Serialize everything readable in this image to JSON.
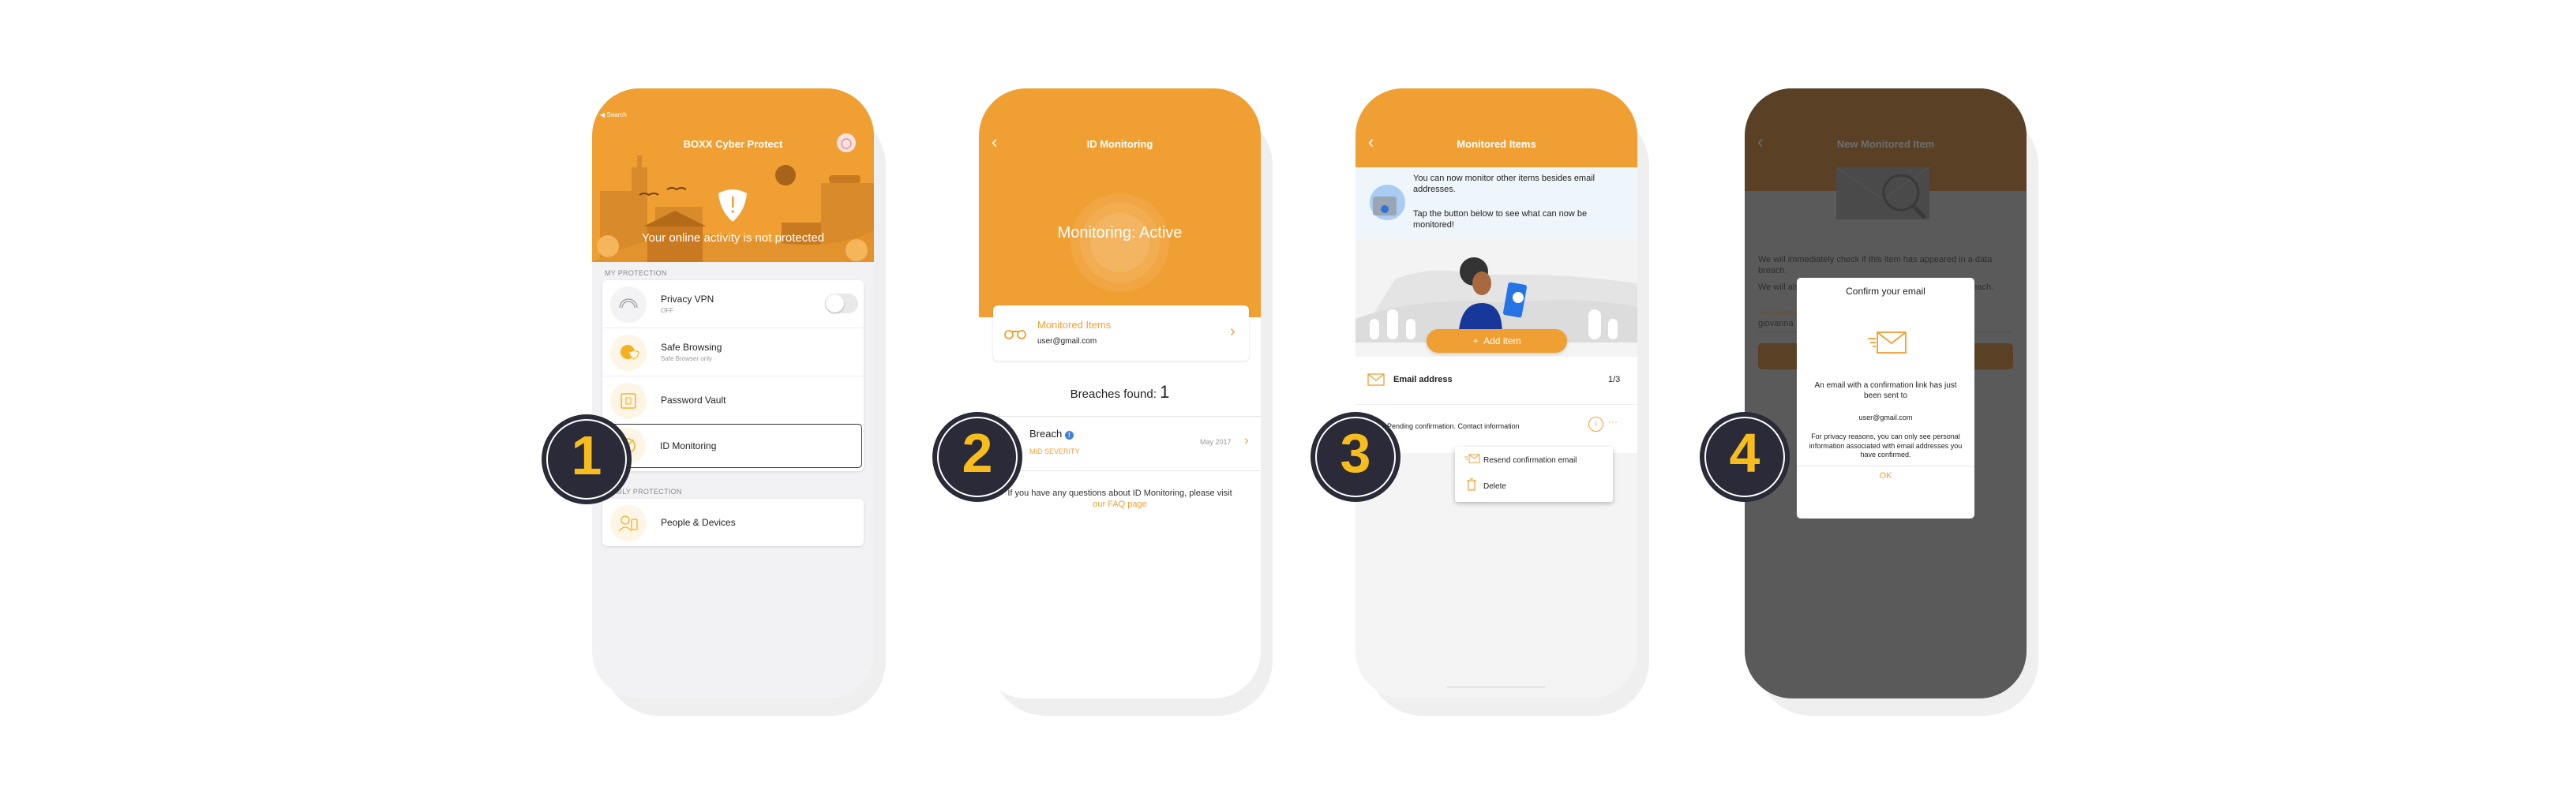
{
  "steps": [
    "1",
    "2",
    "3",
    "4"
  ],
  "colors": {
    "brand_orange": "#f09f33",
    "badge_bg": "#2a2a38",
    "badge_num": "#f6bd1d",
    "overlay": "#5a5a5a"
  },
  "screen1": {
    "back_label": "Search",
    "title": "BOXX Cyber Protect",
    "hero_status": "Your online activity is not protected",
    "section_my": "MY PROTECTION",
    "items": [
      {
        "label": "Privacy VPN",
        "sub": "OFF",
        "icon": "vpn-signal-icon",
        "toggle": false
      },
      {
        "label": "Safe Browsing",
        "sub": "Safe Browser only",
        "icon": "globe-shield-icon"
      },
      {
        "label": "Password Vault",
        "sub": "",
        "icon": "vault-icon"
      },
      {
        "label": "ID Monitoring",
        "sub": "",
        "icon": "radar-icon",
        "highlighted": true
      }
    ],
    "section_family": "FAMILY PROTECTION",
    "family_items": [
      {
        "label": "People & Devices",
        "icon": "person-device-icon"
      }
    ]
  },
  "screen2": {
    "title": "ID Monitoring",
    "status": "Monitoring: Active",
    "monitored_title": "Monitored Items",
    "monitored_email": "user@gmail.com",
    "breaches_label": "Breaches found:",
    "breaches_count": "1",
    "breach": {
      "name": "Breach",
      "severity": "MID SEVERITY",
      "date": "May 2017"
    },
    "faq_text": "If you have any questions about ID Monitoring, please visit",
    "faq_link": "our FAQ page"
  },
  "screen3": {
    "title": "Monitored Items",
    "banner_line1": "You can now monitor other items besides email addresses.",
    "banner_line2": "Tap the button below to see what can now be monitored!",
    "add_button": "Add item",
    "category": "Email address",
    "category_count": "1/3",
    "pending_text": "Pending confirmation. Contact information",
    "menu": [
      {
        "label": "Resend confirmation email",
        "icon": "send-mail-icon"
      },
      {
        "label": "Delete",
        "icon": "trash-icon"
      }
    ]
  },
  "screen4": {
    "title": "New Monitored Item",
    "para1": "We will immediately check if this item has appeared in a data breach.",
    "para2": "We will also let you know if it appears in a future data breach.",
    "field_label": "Email address",
    "field_value": "giovanna",
    "modal": {
      "title": "Confirm your email",
      "body": "An email with a confirmation link has just been sent to",
      "email": "user@gmail.com",
      "note": "For privacy reasons, you can only see personal information associated with email addresses you have confirmed.",
      "ok": "OK"
    }
  }
}
